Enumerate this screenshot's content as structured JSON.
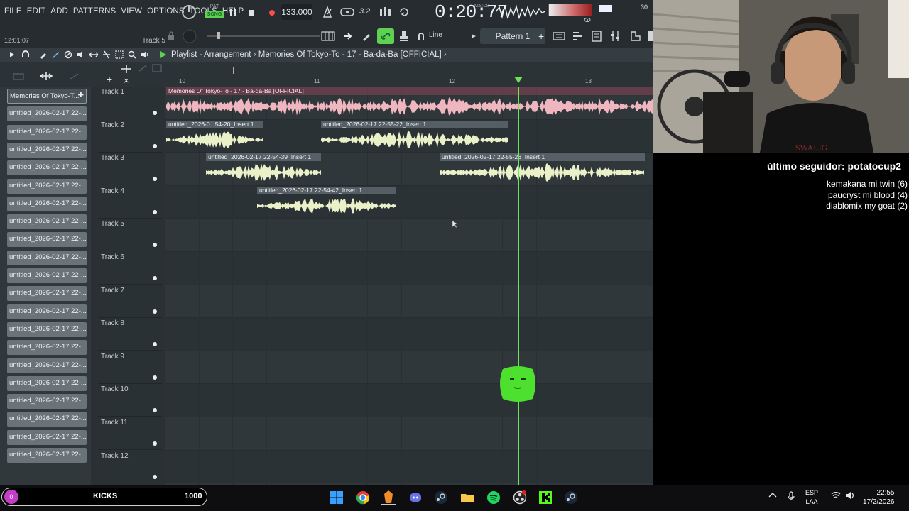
{
  "menu": [
    "FILE",
    "EDIT",
    "ADD",
    "PATTERNS",
    "VIEW",
    "OPTIONS",
    "TOOLS",
    "HELP"
  ],
  "hint": {
    "clock": "12:01:07",
    "track": "Track 5"
  },
  "transport": {
    "pat_label": "PAT",
    "song_label": "SONG",
    "tempo": "133.000",
    "time": "0:20:77",
    "time_unit": "M:S:CS",
    "voices": "30"
  },
  "toolbar": {
    "line_label": "Line",
    "pattern": "Pattern 1",
    "snap_value": "3.2"
  },
  "playlist": {
    "title": "Playlist - Arrangement",
    "song": "Memories Of Tokyo-To - 17 - Ba-da-Ba [OFFICIAL]",
    "bars": [
      "10",
      "11",
      "12",
      "13"
    ],
    "tracks": [
      "Track 1",
      "Track 2",
      "Track 3",
      "Track 4",
      "Track 5",
      "Track 6",
      "Track 7",
      "Track 8",
      "Track 9",
      "Track 10",
      "Track 11",
      "Track 12"
    ],
    "clips": {
      "c1": "Memories Of Tokyo-To - 17 - Ba-da-Ba [OFFICIAL]",
      "c2": "untitled_2026-0...54-20_Insert 1",
      "c3": "untitled_2026-02-17 22-55-22_Insert 1",
      "c4": "untitled_2026-02-17 22-54-39_Insert 1",
      "c5": "untitled_2026-02-17 22-55-26_Insert 1",
      "c6": "untitled_2026-02-17 22-54-42_Insert 1"
    }
  },
  "picker": {
    "active": "Memories Of Tokyo-T...",
    "item": "untitled_2026-02-17 22-...",
    "count": 21
  },
  "overlay": {
    "follower": "último seguidor: potatocup2",
    "shouts": [
      "kemakana mi twin (6)",
      "paucryst mi blood (4)",
      "diablomix my goat (2)"
    ]
  },
  "kick": {
    "badge": "0",
    "label": "KICKS",
    "count": "1000"
  },
  "tray": {
    "lang1": "ESP",
    "lang2": "LAA",
    "time": "22:55",
    "date": "17/2/2026"
  },
  "colors": {
    "accent": "#5fd04f",
    "playhead": "#6ee25a",
    "clip_wave": "#eaf0c8",
    "song_wave": "#f0b6bf",
    "kick_badge": "#c43dc7"
  }
}
